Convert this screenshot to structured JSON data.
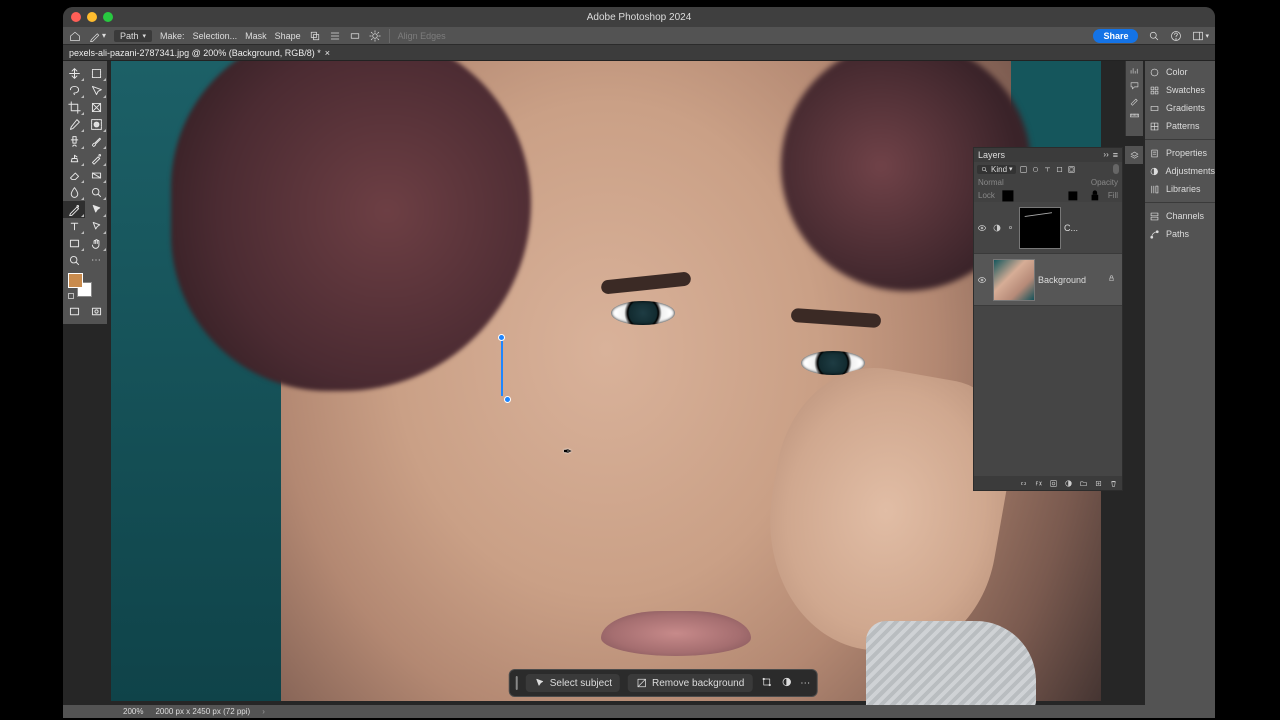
{
  "app_title": "Adobe Photoshop 2024",
  "document": {
    "tab": "pexels-ali-pazani-2787341.jpg @ 200% (Background, RGB/8) *",
    "close": "×"
  },
  "options_bar": {
    "path_dropdown": "Path",
    "make": "Make:",
    "selection": "Selection...",
    "mask": "Mask",
    "shape": "Shape",
    "align": "Align Edges"
  },
  "share": "Share",
  "toolnames": [
    "move",
    "artboard",
    "lasso",
    "polygon-lasso",
    "rect-marquee",
    "quick-select",
    "crop",
    "frame",
    "eyedropper",
    "object-select",
    "spot-heal",
    "brush",
    "clone",
    "history-brush",
    "eraser",
    "gradient",
    "blur",
    "dodge",
    "pen",
    "path-select",
    "type",
    "direct-select",
    "rectangle",
    "hand",
    "zoom",
    "more-tools"
  ],
  "context_bar": {
    "select_subject": "Select subject",
    "remove_bg": "Remove background"
  },
  "dock": {
    "items": [
      [
        "Color",
        "Swatches",
        "Gradients",
        "Patterns"
      ],
      [
        "Properties",
        "Adjustments",
        "Libraries"
      ],
      [
        "Channels",
        "Paths"
      ]
    ]
  },
  "layers": {
    "title": "Layers",
    "kind": "Kind",
    "normal": "Normal",
    "opacity": "Opacity",
    "lock": "Lock",
    "fill": "Fill",
    "layer_curves": "C...",
    "layer_bg": "Background"
  },
  "status": {
    "zoom": "200%",
    "info": "2000 px x 2450 px (72 ppi)",
    "chev": "›"
  }
}
